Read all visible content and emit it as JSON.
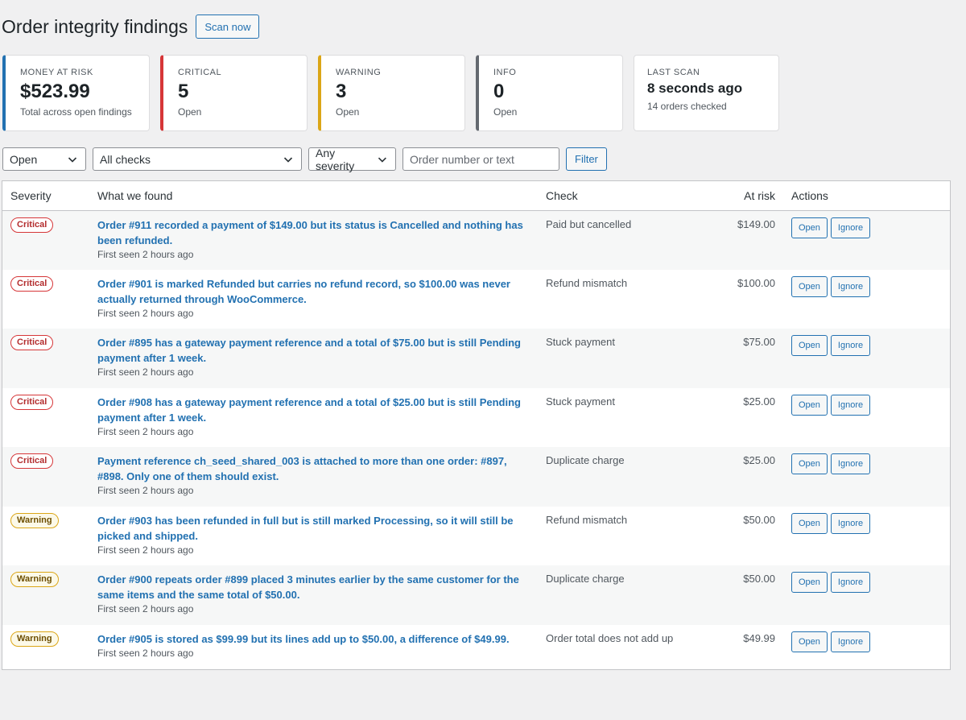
{
  "header": {
    "title": "Order integrity findings",
    "scan_label": "Scan now"
  },
  "cards": [
    {
      "label": "MONEY AT RISK",
      "value": "$523.99",
      "sub": "Total across open findings",
      "accent": "#2271b1"
    },
    {
      "label": "CRITICAL",
      "value": "5",
      "sub": "Open",
      "accent": "#d63638"
    },
    {
      "label": "WARNING",
      "value": "3",
      "sub": "Open",
      "accent": "#dba617"
    },
    {
      "label": "INFO",
      "value": "0",
      "sub": "Open",
      "accent": "#646970"
    },
    {
      "label": "LAST SCAN",
      "value": "8 seconds ago",
      "sub": "14 orders checked"
    }
  ],
  "filters": {
    "status": "Open",
    "checks": "All checks",
    "severity": "Any severity",
    "search_placeholder": "Order number or text",
    "filter_label": "Filter"
  },
  "table": {
    "headers": {
      "severity": "Severity",
      "found": "What we found",
      "check": "Check",
      "risk": "At risk",
      "actions": "Actions"
    },
    "open_label": "Open",
    "ignore_label": "Ignore",
    "rows": [
      {
        "severity": "Critical",
        "title": "Order #911 recorded a payment of $149.00 but its status is Cancelled and nothing has been refunded.",
        "meta": "First seen 2 hours ago",
        "check": "Paid but cancelled",
        "risk": "$149.00"
      },
      {
        "severity": "Critical",
        "title": "Order #901 is marked Refunded but carries no refund record, so $100.00 was never actually returned through WooCommerce.",
        "meta": "First seen 2 hours ago",
        "check": "Refund mismatch",
        "risk": "$100.00"
      },
      {
        "severity": "Critical",
        "title": "Order #895 has a gateway payment reference and a total of $75.00 but is still Pending payment after 1 week.",
        "meta": "First seen 2 hours ago",
        "check": "Stuck payment",
        "risk": "$75.00"
      },
      {
        "severity": "Critical",
        "title": "Order #908 has a gateway payment reference and a total of $25.00 but is still Pending payment after 1 week.",
        "meta": "First seen 2 hours ago",
        "check": "Stuck payment",
        "risk": "$25.00"
      },
      {
        "severity": "Critical",
        "title": "Payment reference ch_seed_shared_003 is attached to more than one order: #897, #898. Only one of them should exist.",
        "meta": "First seen 2 hours ago",
        "check": "Duplicate charge",
        "risk": "$25.00"
      },
      {
        "severity": "Warning",
        "title": "Order #903 has been refunded in full but is still marked Processing, so it will still be picked and shipped.",
        "meta": "First seen 2 hours ago",
        "check": "Refund mismatch",
        "risk": "$50.00"
      },
      {
        "severity": "Warning",
        "title": "Order #900 repeats order #899 placed 3 minutes earlier by the same customer for the same items and the same total of $50.00.",
        "meta": "First seen 2 hours ago",
        "check": "Duplicate charge",
        "risk": "$50.00"
      },
      {
        "severity": "Warning",
        "title": "Order #905 is stored as $99.99 but its lines add up to $50.00, a difference of $49.99.",
        "meta": "First seen 2 hours ago",
        "check": "Order total does not add up",
        "risk": "$49.99"
      }
    ]
  }
}
